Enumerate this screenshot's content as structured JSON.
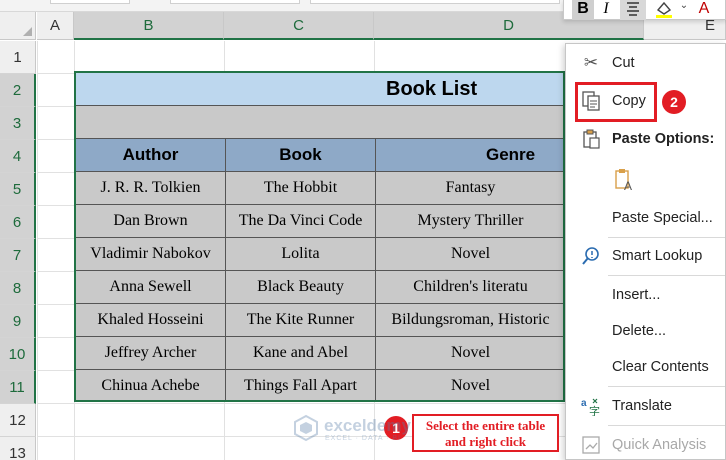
{
  "columns": [
    "A",
    "B",
    "C",
    "D",
    "E"
  ],
  "rows": [
    "1",
    "2",
    "3",
    "4",
    "5",
    "6",
    "7",
    "8",
    "9",
    "10",
    "11",
    "12",
    "13"
  ],
  "mini_toolbar": {
    "bold": "B",
    "italic": "I",
    "font_color_glyph": "A"
  },
  "table": {
    "title": "Book List",
    "headers": [
      "Author",
      "Book",
      "Genre"
    ],
    "rows": [
      [
        "J. R. R. Tolkien",
        "The Hobbit",
        "Fantasy"
      ],
      [
        "Dan Brown",
        "The Da Vinci Code",
        "Mystery Thriller"
      ],
      [
        "Vladimir Nabokov",
        "Lolita",
        "Novel"
      ],
      [
        "Anna Sewell",
        "Black Beauty",
        "Children's literatu"
      ],
      [
        "Khaled Hosseini",
        "The Kite Runner",
        "Bildungsroman, Historic"
      ],
      [
        "Jeffrey Archer",
        "Kane and Abel",
        "Novel"
      ],
      [
        "Chinua Achebe",
        "Things Fall Apart",
        "Novel"
      ]
    ]
  },
  "context_menu": {
    "cut": "Cut",
    "copy": "Copy",
    "paste_options": "Paste Options:",
    "paste_special": "Paste Special...",
    "smart_lookup": "Smart Lookup",
    "insert": "Insert...",
    "delete": "Delete...",
    "clear_contents": "Clear Contents",
    "translate": "Translate",
    "quick_analysis": "Quick Analysis"
  },
  "annotations": {
    "badge_1": "1",
    "badge_2": "2",
    "note": "Select the entire table and right click"
  },
  "watermark": {
    "name": "exceldemy",
    "tagline": "EXCEL · DATA · BI"
  },
  "colors": {
    "accent": "#217346",
    "highlight": "#e21d24",
    "title_fill": "#bdd7ee",
    "header_fill": "#8ea9c7"
  }
}
